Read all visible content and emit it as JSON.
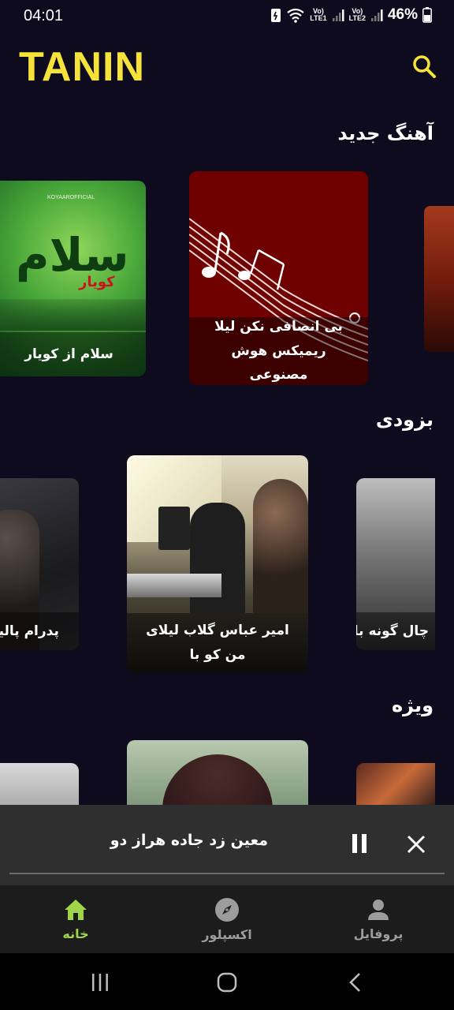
{
  "status_bar": {
    "time": "04:01",
    "lte1": "LTE1",
    "lte2": "LTE2",
    "volte": "Vo)",
    "battery": "46%"
  },
  "header": {
    "logo": "TANIN"
  },
  "sections": [
    {
      "title": "آهنگ جدید",
      "cards": [
        {
          "title": "سلام از کویار",
          "art_text": "سلام",
          "art_sub": "کویار",
          "art_handle": "KOYAAROFFICIAL"
        },
        {
          "title": "بی انصافی نکن لیلا ریمیکس هوش مصنوعی"
        }
      ]
    },
    {
      "title": "بزودی",
      "cards": [
        {
          "title": "پدرام پالیز"
        },
        {
          "title": "امیر عباس گلاب لیلای من کو  با"
        },
        {
          "title": "چال گونه  با"
        }
      ]
    },
    {
      "title": "ویژه",
      "cards": []
    }
  ],
  "player": {
    "title": "معین زد جاده هراز  دو"
  },
  "nav": [
    {
      "label": "خانه",
      "icon": "home-icon",
      "active": true
    },
    {
      "label": "اکسپلور",
      "icon": "compass-icon",
      "active": false
    },
    {
      "label": "پروفایل",
      "icon": "person-icon",
      "active": false
    }
  ],
  "colors": {
    "background": "#0f0b1e",
    "logo": "#f6e33a",
    "accent": "#9ed54b",
    "player": "#2f2f2f"
  }
}
